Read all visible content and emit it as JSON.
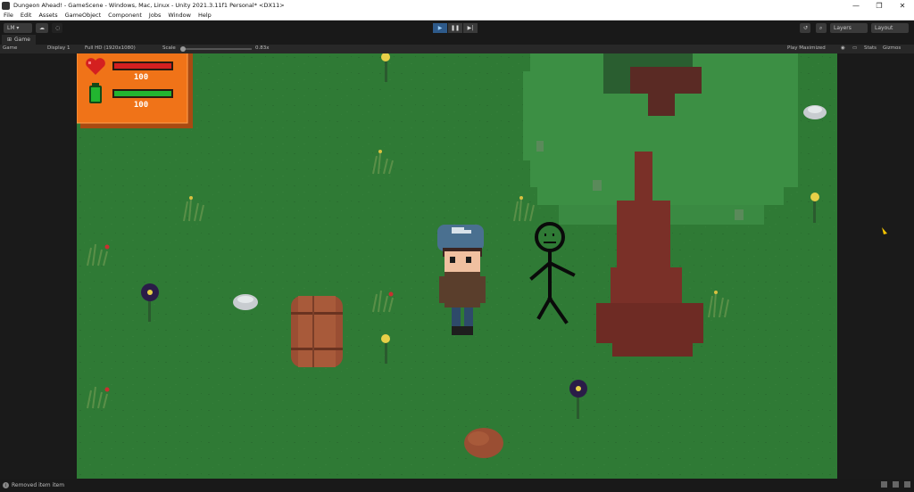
{
  "window": {
    "title": "Dungeon Ahead! - GameScene - Windows, Mac, Linux - Unity 2021.3.11f1 Personal* <DX11>",
    "controls": [
      "—",
      "❐",
      "✕"
    ]
  },
  "menu": [
    "File",
    "Edit",
    "Assets",
    "GameObject",
    "Component",
    "Jobs",
    "Window",
    "Help"
  ],
  "toolbar": {
    "account_label": "LM ▾",
    "play_icon": "▶",
    "pause_icon": "❚❚",
    "step_icon": "▶|",
    "layers_label": "Layers",
    "layout_label": "Layout"
  },
  "tab": {
    "label": "Game"
  },
  "gamebar": {
    "mode": "Game",
    "display": "Display 1",
    "resolution": "Full HD (1920x1080)",
    "scale_label": "Scale",
    "scale_value": "0.83x",
    "play_mode": "Play Maximized",
    "stats": "Stats",
    "gizmos": "Gizmos"
  },
  "hud": {
    "health_value": "100",
    "stamina_value": "100",
    "health_fraction": 1.0,
    "stamina_fraction": 1.0,
    "health_color": "#d42020",
    "stamina_color": "#22b530",
    "panel_color": "#f07318"
  },
  "status": {
    "message": "Removed item item"
  },
  "scene_colors": {
    "grass": "#2f7a35",
    "tree_canopy": "#3c8f44",
    "tree_trunk": "#7a3028",
    "barrel": "#9a4e33"
  }
}
